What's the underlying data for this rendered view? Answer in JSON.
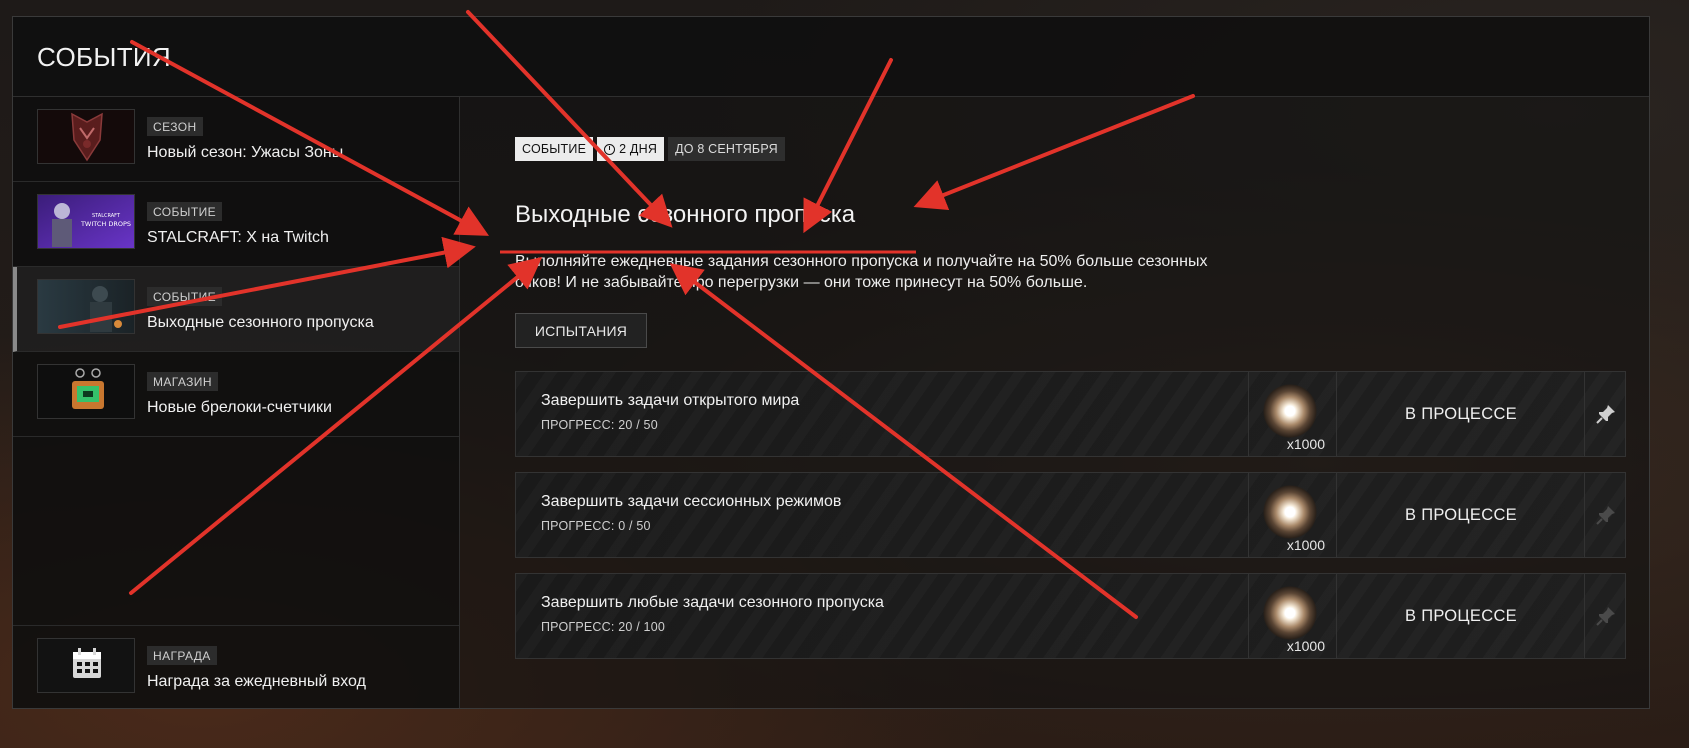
{
  "header": {
    "title": "СОБЫТИЯ"
  },
  "sidebar": {
    "items": [
      {
        "badge": "СЕЗОН",
        "title": "Новый сезон: Ужасы Зоны",
        "icon": "season-emblem-thumbnail"
      },
      {
        "badge": "СОБЫТИЕ",
        "title": "STALCRAFT: X на Twitch",
        "icon": "twitch-drops-thumbnail",
        "thumb_text": "TWITCH DROPS"
      },
      {
        "badge": "СОБЫТИЕ",
        "title": "Выходные сезонного пропуска",
        "icon": "stalker-thumbnail"
      },
      {
        "badge": "МАГАЗИН",
        "title": "Новые брелоки-счетчики",
        "icon": "keychain-thumbnail"
      }
    ],
    "footer_item": {
      "badge": "НАГРАДА",
      "title": "Награда за ежедневный вход",
      "icon": "calendar-icon"
    }
  },
  "main": {
    "tags": {
      "type": "СОБЫТИЕ",
      "duration": "2 ДНЯ",
      "until": "ДО 8 СЕНТЯБРЯ"
    },
    "title": "Выходные сезонного пропуска",
    "description": "Выполняйте ежедневные задания сезонного пропуска и получайте на 50% больше сезонных очков! И не забывайте про перегрузки — они тоже принесут на 50% больше.",
    "challenges_button": "ИСПЫТАНИЯ",
    "tasks": [
      {
        "name": "Завершить задачи открытого мира",
        "progress": "ПРОГРЕСС: 20 / 50",
        "reward_count": "x1000",
        "status": "В ПРОЦЕССЕ",
        "pinned": true
      },
      {
        "name": "Завершить задачи сессионных режимов",
        "progress": "ПРОГРЕСС: 0 / 50",
        "reward_count": "x1000",
        "status": "В ПРОЦЕССЕ",
        "pinned": false
      },
      {
        "name": "Завершить любые задачи сезонного пропуска",
        "progress": "ПРОГРЕСС: 20 / 100",
        "reward_count": "x1000",
        "status": "В ПРОЦЕССЕ",
        "pinned": false
      }
    ]
  },
  "colors": {
    "annotation_red": "#e2332a",
    "pin_active": "#cfcfcf",
    "pin_inactive": "#4a4a4a"
  }
}
